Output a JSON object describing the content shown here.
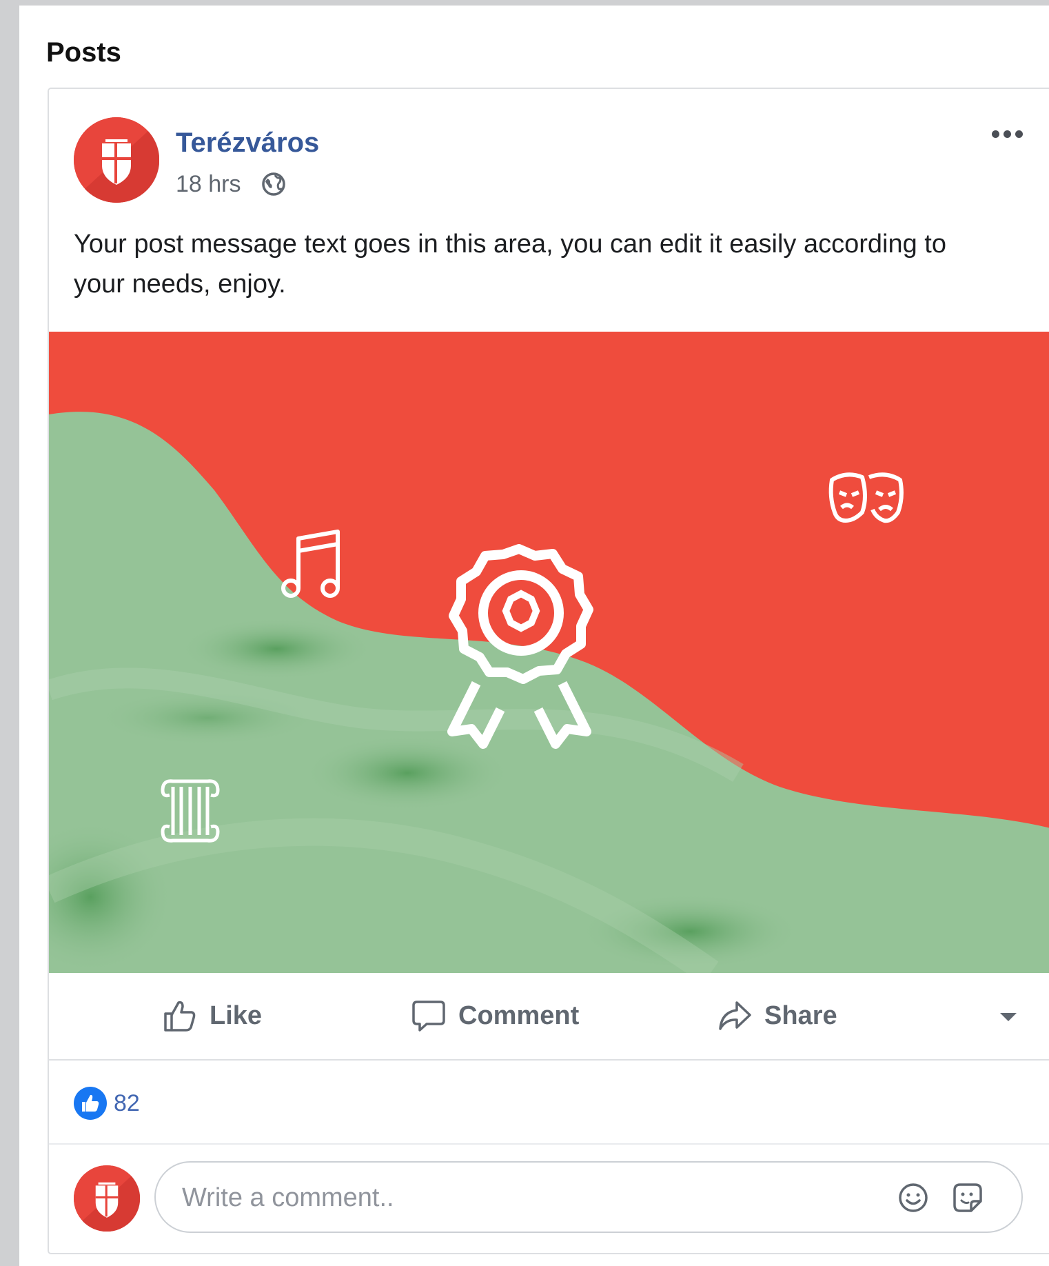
{
  "section": {
    "title": "Posts"
  },
  "post": {
    "author": "Terézváros",
    "time": "18 hrs",
    "privacy_icon": "globe-icon",
    "more_icon": "more-options-icon",
    "message": "Your post message text goes in this area, you can edit it easily according to your needs, enjoy.",
    "image_icons": [
      "music-note-icon",
      "theater-masks-icon",
      "award-rosette-icon",
      "column-icon"
    ]
  },
  "actions": {
    "like_label": "Like",
    "comment_label": "Comment",
    "share_label": "Share",
    "dropdown_icon": "caret-down-icon"
  },
  "reactions": {
    "icon": "like-reaction-icon",
    "count": "82"
  },
  "comment_composer": {
    "placeholder": "Write a comment..",
    "value": ""
  },
  "colors": {
    "brand_red": "#e8453c",
    "hills_green": "#95c397",
    "link_blue": "#365899",
    "reaction_blue": "#1877f2",
    "text_gray": "#606770"
  }
}
